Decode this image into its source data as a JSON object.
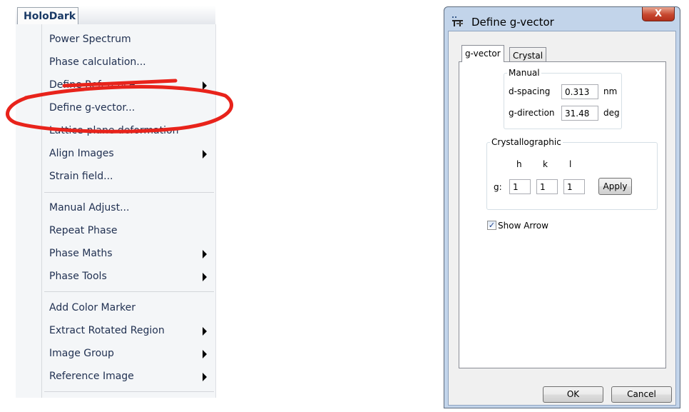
{
  "menu": {
    "title": "HoloDark",
    "items": [
      {
        "label": "Power Spectrum",
        "submenu": false
      },
      {
        "label": "Phase calculation...",
        "submenu": false
      },
      {
        "label": "Define Reference",
        "submenu": true
      },
      {
        "label": "Define g-vector...",
        "submenu": false
      },
      {
        "label": "Lattice-plane deformation",
        "submenu": false
      },
      {
        "label": "Align Images",
        "submenu": true
      },
      {
        "label": "Strain field...",
        "submenu": false
      },
      {
        "label": "Manual Adjust...",
        "submenu": false
      },
      {
        "label": "Repeat Phase",
        "submenu": false
      },
      {
        "label": "Phase Maths",
        "submenu": true
      },
      {
        "label": "Phase Tools",
        "submenu": true
      },
      {
        "label": "Add Color Marker",
        "submenu": false
      },
      {
        "label": "Extract Rotated Region",
        "submenu": true
      },
      {
        "label": "Image Group",
        "submenu": true
      },
      {
        "label": "Reference Image",
        "submenu": true
      }
    ],
    "annotation_color": "#e8231b"
  },
  "dialog": {
    "title": "Define g-vector",
    "close_glyph": "X",
    "tabs": [
      {
        "label": "g-vector",
        "active": true
      },
      {
        "label": "Crystal",
        "active": false
      }
    ],
    "manual": {
      "legend": "Manual",
      "d_spacing_label": "d-spacing",
      "d_spacing_value": "0.313",
      "d_spacing_unit": "nm",
      "g_direction_label": "g-direction",
      "g_direction_value": "31.48",
      "g_direction_unit": "deg"
    },
    "crystallographic": {
      "legend": "Crystallographic",
      "h_label": "h",
      "k_label": "k",
      "l_label": "l",
      "g_label": "g:",
      "h_value": "1",
      "k_value": "1",
      "l_value": "1",
      "apply_label": "Apply"
    },
    "show_arrow_label": "Show Arrow",
    "show_arrow_checked": true,
    "ok_label": "OK",
    "cancel_label": "Cancel"
  }
}
